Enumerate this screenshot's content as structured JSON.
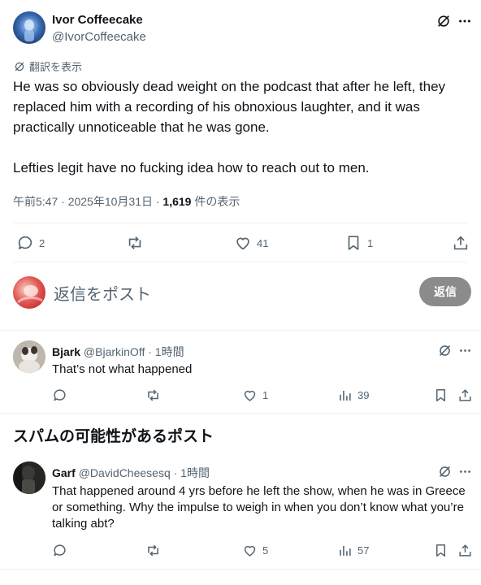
{
  "main_post": {
    "display_name": "Ivor Coffeecake",
    "handle": "@IvorCoffeecake",
    "translate_label": "翻訳を表示",
    "text_paragraph_1": "He was so obviously dead weight on the podcast that after he left, they replaced him with a recording of his obnoxious laughter, and it was practically unnoticeable that he was gone.",
    "text_paragraph_2": "Lefties legit have no fucking idea how to reach out to men.",
    "timestamp": "午前5:47 · 2025年10月31日 · ",
    "views_count": "1,619",
    "views_label": " 件の表示",
    "stats": {
      "replies": "2",
      "reposts": "",
      "likes": "41",
      "bookmarks": "1"
    }
  },
  "composer": {
    "placeholder": "返信をポスト",
    "reply_button": "返信"
  },
  "replies": [
    {
      "display_name": "Bjark",
      "handle": "@BjarkinOff",
      "time": "· 1時間",
      "text": "That’s not what happened",
      "stats": {
        "replies": "",
        "reposts": "",
        "likes": "1",
        "views": "39"
      }
    }
  ],
  "spam_section": {
    "heading": "スパムの可能性があるポスト"
  },
  "spam_replies": [
    {
      "display_name": "Garf",
      "handle": "@DavidCheesesq",
      "time": "· 1時間",
      "text_line_1": "That happened around 4 yrs before he left the show, when he was in Greece",
      "text_line_2": "or something. Why the impulse to weigh in when you don’t know what you’re",
      "text_line_3": "talking abt?",
      "stats": {
        "replies": "",
        "reposts": "",
        "likes": "5",
        "views": "57"
      }
    }
  ],
  "colors": {
    "text": "#0f1419",
    "secondary": "#536471",
    "divider": "#eff3f4",
    "reply_button_bg": "#8b8b8b"
  },
  "icons": [
    "grok-slash-icon",
    "more-icon",
    "reply-icon",
    "repost-icon",
    "like-icon",
    "bookmark-icon",
    "share-icon",
    "views-icon"
  ]
}
